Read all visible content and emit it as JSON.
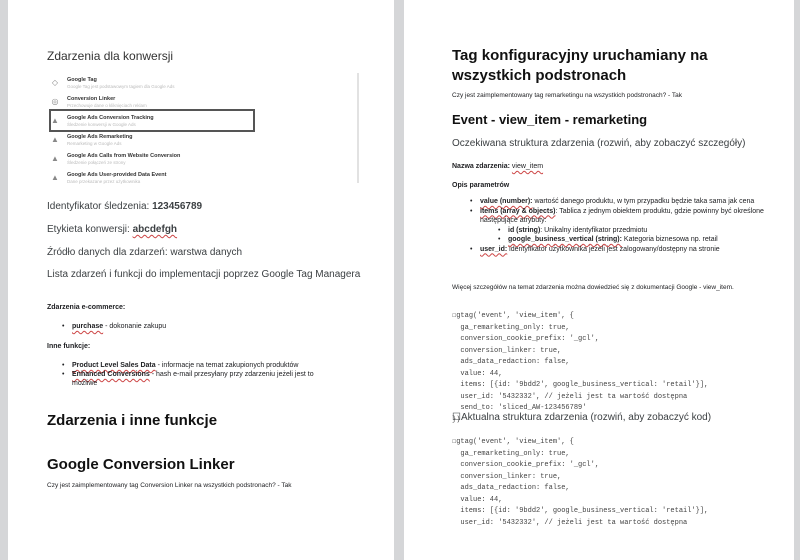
{
  "left": {
    "conversion_heading": "Zdarzenia dla konwersji",
    "tags": [
      {
        "name": "Google Tag",
        "desc": "Google Tag jest podstawowym tagiem dla Google Ads",
        "icon": "google-tag-icon"
      },
      {
        "name": "Conversion Linker",
        "desc": "Przechowuje dane o kliknięciach reklam",
        "icon": "conversion-linker-icon"
      },
      {
        "name": "Google Ads Conversion Tracking",
        "desc": "Śledzenie konwersji w Google Ads",
        "icon": "google-ads-icon"
      },
      {
        "name": "Google Ads Remarketing",
        "desc": "Remarketing w Google Ads",
        "icon": "google-ads-icon"
      },
      {
        "name": "Google Ads Calls from Website Conversion",
        "desc": "Śledzenie połączeń ze strony",
        "icon": "google-ads-icon"
      },
      {
        "name": "Google Ads User-provided Data Event",
        "desc": "Dane przekazane przez użytkownika",
        "icon": "google-ads-icon"
      }
    ],
    "tracking_id_label": "Identyfikator śledzenia:",
    "tracking_id_value": "123456789",
    "conversion_label_label": "Etykieta konwersji:",
    "conversion_label_value": "abcdefgh",
    "data_source": "Źródło danych dla zdarzeń: warstwa danych",
    "events_list_heading": "Lista zdarzeń i funkcji do implementacji poprzez Google Tag Managera",
    "ecommerce_heading": "Zdarzenia e-commerce:",
    "ecommerce_items": [
      {
        "term": "purchase",
        "desc": " - dokonanie zakupu"
      }
    ],
    "other_heading": "Inne funkcje:",
    "other_items": [
      {
        "term": "Product Level Sales Data",
        "desc": " - informacje na temat zakupionych produktów"
      },
      {
        "term": "Enhanced Conversions",
        "desc": " - hash e-mail przesyłany przy zdarzeniu jeżeli jest to możliwe"
      }
    ],
    "section_heading": "Zdarzenia i inne funkcje",
    "linker_heading": "Google Conversion Linker",
    "linker_question": "Czy jest zaimplementowany tag Conversion Linker na wszystkich podstronach? -  Tak"
  },
  "right": {
    "config_heading_line1": "Tag konfiguracyjny uruchamiany na",
    "config_heading_line2": "wszystkich podstronach",
    "remarketing_question": "Czy jest zaimplementowany tag remarketingu na wszystkich podstronach? -  Tak",
    "event_heading": "Event - view_item - remarketing",
    "expected_structure": "Oczekiwana struktura zdarzenia (rozwiń, aby zobaczyć szczegóły)",
    "event_name_label": "Nazwa zdarzenia:",
    "event_name_value": "view_item",
    "params_heading": "Opis parametrów",
    "params": [
      {
        "term": "value (number):",
        "desc": " wartość danego produktu, w tym przypadku będzie taka sama jak cena"
      },
      {
        "term": "items (array & objects)",
        "desc": ": Tablica z jednym obiektem produktu, gdzie powinny być określone następujące atrybuty:"
      },
      {
        "term": "user_id:",
        "desc": " identyfikator użytkownika jeżeli jest zalogowany/dostępny na stronie"
      }
    ],
    "sub_params": [
      {
        "term": "id (string)",
        "desc": ": Unikalny identyfikator przedmiotu"
      },
      {
        "term": "google_business_vertical (string):",
        "desc": " Kategoria biznesowa np. retail"
      }
    ],
    "more_details": "Więcej szczegółów na temat zdarzenia można dowiedzieć się z dokumentacji Google - view_item.",
    "code_expected": [
      "☐gtag('event', 'view_item', {",
      "  ga_remarketing_only: true,",
      "  conversion_cookie_prefix: '_gcl',",
      "  conversion_linker: true,",
      "  ads_data_redaction: false,",
      "  value: 44,",
      "  items: [{id: '9bdd2', google_business_vertical: 'retail'}],",
      "  user_id: '5432332', // jeżeli jest ta wartość dostępna",
      "  send_to: 'sliced_AW-123456789'",
      "})"
    ],
    "actual_structure": "☐Aktualna struktura zdarzenia (rozwiń, aby zobaczyć kod)",
    "code_actual": [
      "☐gtag('event', 'view_item', {",
      "  ga_remarketing_only: true,",
      "  conversion_cookie_prefix: '_gcl',",
      "  conversion_linker: true,",
      "  ads_data_redaction: false,",
      "  value: 44,",
      "  items: [{id: '9bdd2', google_business_vertical: 'retail'}],",
      "  user_id: '5432332', // jeżeli jest ta wartość dostępna"
    ]
  }
}
